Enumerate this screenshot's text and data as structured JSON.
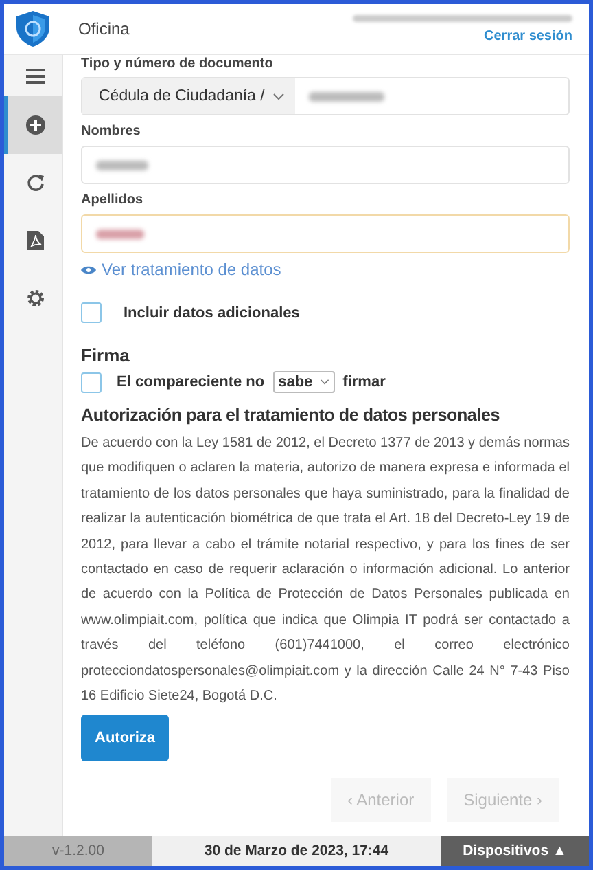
{
  "header": {
    "title": "Oficina",
    "logout": "Cerrar sesión"
  },
  "sidebar": {
    "items": [
      {
        "kind": "menu",
        "selected": false
      },
      {
        "kind": "add",
        "selected": true
      },
      {
        "kind": "refresh",
        "selected": false
      },
      {
        "kind": "pdf",
        "selected": false
      },
      {
        "kind": "settings",
        "selected": false
      }
    ]
  },
  "form": {
    "document_label": "Tipo y número de documento",
    "document_type": "Cédula de Ciudadanía /",
    "names_label": "Nombres",
    "surnames_label": "Apellidos",
    "privacy_link": "Ver tratamiento de datos",
    "extra_data": {
      "label": "Incluir datos adicionales",
      "checked": false
    }
  },
  "signature": {
    "title": "Firma",
    "checked": false,
    "label_before": "El compareciente no",
    "choice": "sabe",
    "label_after": "firmar"
  },
  "authorization": {
    "title": "Autorización para el tratamiento de datos personales",
    "text": "De acuerdo con la Ley 1581 de 2012, el Decreto 1377 de 2013 y demás normas que modifiquen o aclaren la materia, autorizo de manera expresa e informada el tratamiento de los datos personales que haya suministrado, para la finalidad de realizar la autenticación biométrica de que trata el Art. 18 del Decreto-Ley 19 de 2012, para llevar a cabo el trámite notarial respectivo, y para los fines de ser contactado en caso de requerir aclaración o información adicional. Lo anterior de acuerdo con la Política de Protección de Datos Personales publicada en www.olimpiait.com, política que indica que Olimpia IT podrá ser contactado a través del teléfono (601)7441000, el correo electrónico protecciondatospersonales@olimpiait.com y la dirección Calle 24 N° 7-43 Piso 16 Edificio Siete24, Bogotá D.C.",
    "button": "Autoriza"
  },
  "navigation": [
    {
      "label": "‹ Anterior",
      "disabled": true
    },
    {
      "label": "Siguiente ›",
      "disabled": true
    }
  ],
  "status_bar": {
    "version": "v-1.2.00",
    "datetime": "30 de Marzo de 2023, 17:44",
    "devices": "Dispositivos ▲"
  }
}
